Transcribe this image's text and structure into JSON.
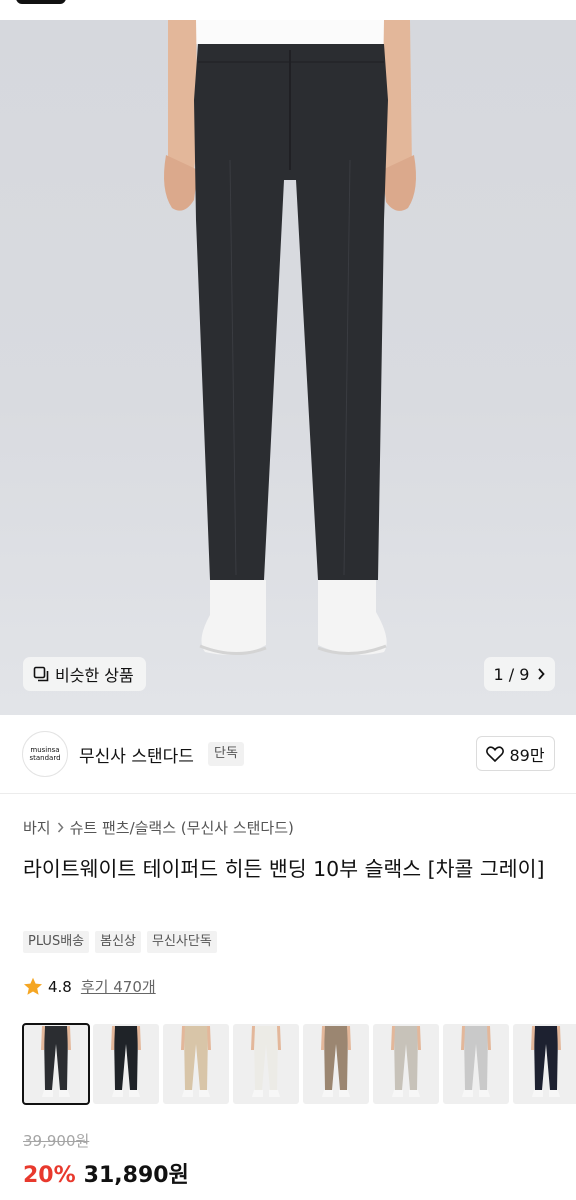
{
  "gallery": {
    "similar_label": "비슷한 상품",
    "page_counter": "1 / 9"
  },
  "brand": {
    "logo_line1": "musinsa",
    "logo_line2": "standard",
    "name": "무신사 스탠다드",
    "badge": "단독",
    "likes": "89만"
  },
  "breadcrumb": {
    "items": [
      "바지",
      "슈트 팬츠/슬랙스 (무신사 스탠다드)"
    ]
  },
  "product": {
    "title": "라이트웨이트 테이퍼드 히든 밴딩 10부 슬랙스 [차콜 그레이]",
    "tags": [
      "PLUS배송",
      "봄신상",
      "무신사단독"
    ],
    "rating": "4.8",
    "reviews": "후기 470개"
  },
  "variants": {
    "colors": [
      "#2b2d31",
      "#1f2328",
      "#d8c5a8",
      "#ecebe6",
      "#9b8671",
      "#c7c2b9",
      "#c9c9c9",
      "#1d2130"
    ]
  },
  "price": {
    "original": "39,900원",
    "discount": "20%",
    "sale": "31,890원"
  },
  "colors": {
    "accent_red": "#e8392d"
  }
}
